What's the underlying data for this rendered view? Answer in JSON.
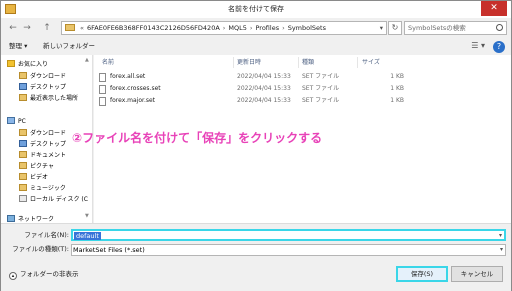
{
  "window": {
    "title": "名前を付けて保存",
    "close_glyph": "✕"
  },
  "address": {
    "back_glyph": "←",
    "forward_glyph": "→",
    "up_glyph": "↑",
    "overflow": "«",
    "crumbs": [
      "6FAE0FE6B368FF0143C2126D56FD420A",
      "MQL5",
      "Profiles",
      "SymbolSets"
    ],
    "separator": "›",
    "dropdown_glyph": "▾",
    "refresh_glyph": "↻",
    "search_placeholder": "SymbolSetsの検索"
  },
  "toolbar": {
    "organize": "整理 ▾",
    "new_folder": "新しいフォルダー",
    "view_glyph": "☰ ▾",
    "help": "?"
  },
  "sidebar": {
    "scroll_up": "▲",
    "scroll_down": "▼",
    "items": [
      {
        "label": "お気に入り",
        "icon": "star-icon"
      },
      {
        "label": "ダウンロード",
        "icon": "folder-icon"
      },
      {
        "label": "デスクトップ",
        "icon": "folder-icon"
      },
      {
        "label": "最近表示した場所",
        "icon": "folder-icon"
      },
      {
        "label": "PC",
        "icon": "pc-icon"
      },
      {
        "label": "ダウンロード",
        "icon": "folder-icon"
      },
      {
        "label": "デスクトップ",
        "icon": "folder-icon"
      },
      {
        "label": "ドキュメント",
        "icon": "folder-icon"
      },
      {
        "label": "ピクチャ",
        "icon": "folder-icon"
      },
      {
        "label": "ビデオ",
        "icon": "folder-icon"
      },
      {
        "label": "ミュージック",
        "icon": "folder-icon"
      },
      {
        "label": "ローカル ディスク (C",
        "icon": "disk-icon"
      },
      {
        "label": "ネットワーク",
        "icon": "network-icon"
      }
    ]
  },
  "file_list": {
    "columns": [
      "名前",
      "更新日時",
      "種類",
      "サイズ"
    ],
    "rows": [
      {
        "name": "forex.all.set",
        "modified": "2022/04/04 15:33",
        "type": "SET ファイル",
        "size": "1 KB"
      },
      {
        "name": "forex.crosses.set",
        "modified": "2022/04/04 15:33",
        "type": "SET ファイル",
        "size": "1 KB"
      },
      {
        "name": "forex.major.set",
        "modified": "2022/04/04 15:33",
        "type": "SET ファイル",
        "size": "1 KB"
      }
    ]
  },
  "annotation": {
    "text": "②ファイル名を付けて「保存」をクリックする",
    "color": "#e842b8"
  },
  "form": {
    "filename_label": "ファイル名(N):",
    "filename_value": "default",
    "filetype_label": "ファイルの種類(T):",
    "filetype_value": "MarketSet Files (*.set)",
    "dropdown_glyph": "▾"
  },
  "footer": {
    "hide_folders_glyph": "▴",
    "hide_folders": "フォルダーの非表示",
    "save": "保存(S)",
    "cancel": "キャンセル"
  },
  "colors": {
    "highlight": "#3ad6e8",
    "selection": "#3774d8",
    "close": "#c7302b"
  }
}
